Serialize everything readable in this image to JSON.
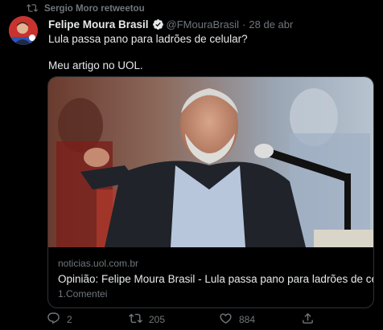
{
  "retweet": {
    "label": "Sergio Moro retweetou",
    "icon": "retweet-icon"
  },
  "author": {
    "name": "Felipe Moura Brasil",
    "handle": "@FMouraBrasil",
    "separator": "·",
    "date": "28 de abr",
    "verified_icon": "verified-badge-icon"
  },
  "tweet": {
    "lines": [
      "Lula passa pano para ladrões de celular?",
      "Meu artigo no UOL."
    ]
  },
  "card": {
    "domain": "noticias.uol.com.br",
    "title": "Opinião: Felipe Moura Brasil - Lula passa pano para ladrões de celular?",
    "description": "1.Comentei"
  },
  "actions": {
    "reply_count": "2",
    "retweet_count": "205",
    "like_count": "884",
    "share_icon": "share-icon"
  },
  "colors": {
    "background": "#000000",
    "text": "#e7e9ea",
    "muted": "#71767b",
    "verified": "#1d9bf0",
    "border": "#2f3336"
  }
}
